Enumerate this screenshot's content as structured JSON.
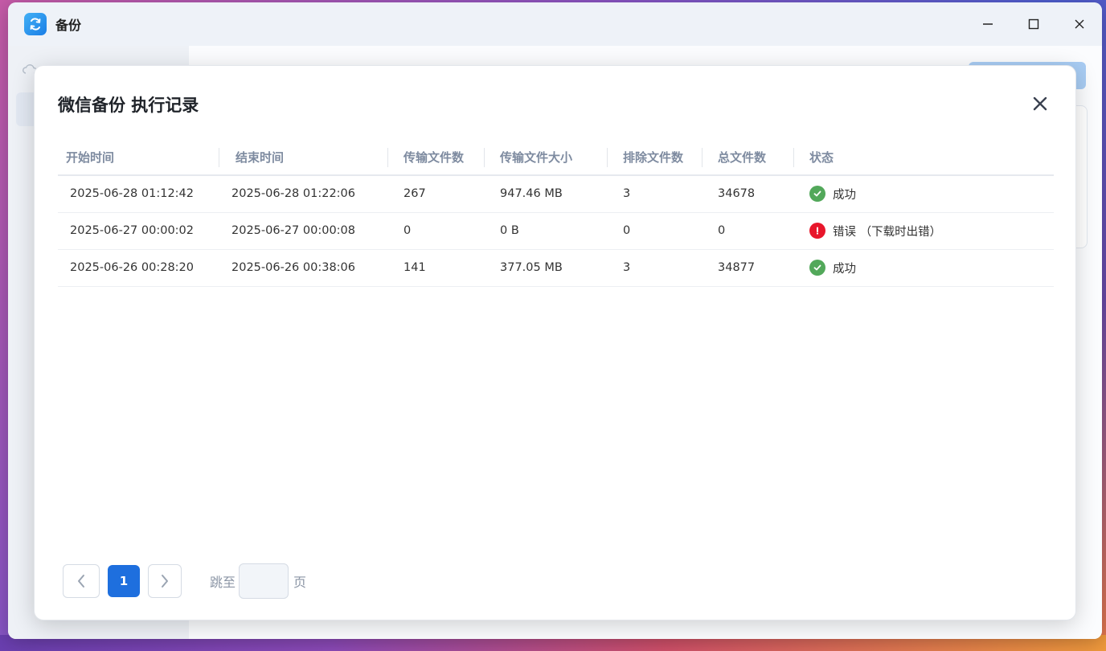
{
  "window": {
    "title": "备份"
  },
  "modal": {
    "title": "微信备份 执行记录",
    "columns": [
      "开始时间",
      "结束时间",
      "传输文件数",
      "传输文件大小",
      "排除文件数",
      "总文件数",
      "状态"
    ],
    "rows": [
      {
        "start": "2025-06-28 01:12:42",
        "end": "2025-06-28 01:22:06",
        "transferred": "267",
        "size": "947.46 MB",
        "excluded": "3",
        "total": "34678",
        "status": "成功",
        "status_type": "success"
      },
      {
        "start": "2025-06-27 00:00:02",
        "end": "2025-06-27 00:00:08",
        "transferred": "0",
        "size": "0 B",
        "excluded": "0",
        "total": "0",
        "status": "错误 （下载时出错）",
        "status_type": "error"
      },
      {
        "start": "2025-06-26 00:28:20",
        "end": "2025-06-26 00:38:06",
        "transferred": "141",
        "size": "377.05 MB",
        "excluded": "3",
        "total": "34877",
        "status": "成功",
        "status_type": "success"
      }
    ]
  },
  "pagination": {
    "current_page": "1",
    "jump_label": "跳至",
    "jump_suffix": "页",
    "jump_value": ""
  },
  "colors": {
    "accent": "#1e6fde",
    "success": "#52a85a",
    "error": "#e8162b"
  },
  "icons": {
    "app": "sync-icon",
    "close": "close-icon",
    "prev": "chevron-left-icon",
    "next": "chevron-right-icon",
    "success": "check-circle-icon",
    "error": "alert-circle-icon"
  }
}
